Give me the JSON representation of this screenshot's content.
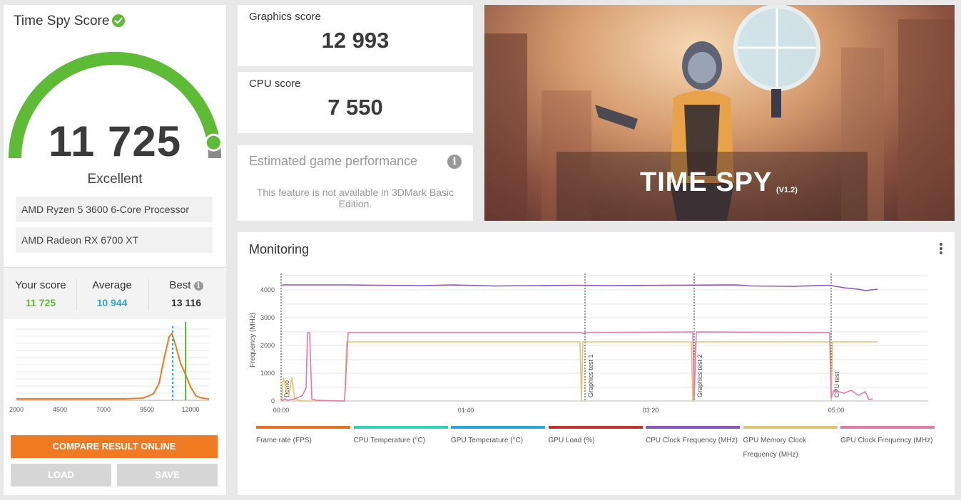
{
  "left": {
    "title": "Time Spy Score",
    "score": "11 725",
    "rating": "Excellent",
    "hardware": [
      "AMD Ryzen 5 3600 6-Core Processor",
      "AMD Radeon RX 6700 XT"
    ],
    "gauge_fraction": 0.95,
    "compare": {
      "your_label": "Your score",
      "your_value": "11 725",
      "avg_label": "Average",
      "avg_value": "10 944",
      "best_label": "Best",
      "best_value": "13 116"
    },
    "hist_ticks": [
      "2000",
      "4500",
      "7000",
      "9500",
      "12000"
    ],
    "buttons": {
      "compare": "COMPARE RESULT ONLINE",
      "load": "LOAD",
      "save": "SAVE"
    },
    "colors": {
      "green": "#5dbb36",
      "blue": "#29a9e0",
      "orange": "#f07a21"
    }
  },
  "graphics": {
    "label": "Graphics score",
    "value": "12 993"
  },
  "cpu": {
    "label": "CPU score",
    "value": "7 550"
  },
  "estimate": {
    "title": "Estimated game performance",
    "message": "This feature is not available in 3DMark Basic Edition."
  },
  "hero": {
    "title": "TIME SPY",
    "version": "(V1.2)"
  },
  "monitoring": {
    "title": "Monitoring",
    "y_axis_label": "Frequency (MHz)",
    "y_ticks": [
      "0",
      "1000",
      "2000",
      "3000",
      "4000"
    ],
    "x_ticks": [
      "00:00",
      "01:40",
      "03:20",
      "05:00"
    ],
    "markers": [
      "Demo",
      "Graphics test 1",
      "Graphics test 2",
      "CPU test"
    ],
    "legend": [
      {
        "label": "Frame rate (FPS)",
        "color": "#e8731f"
      },
      {
        "label": "CPU Temperature (°C)",
        "color": "#2fd6b3"
      },
      {
        "label": "GPU Temperature (°C)",
        "color": "#29a9e0"
      },
      {
        "label": "GPU Load (%)",
        "color": "#c8312f"
      },
      {
        "label": "CPU Clock Frequency (MHz)",
        "color": "#8e52c9"
      },
      {
        "label": "GPU Memory Clock Frequency (MHz)",
        "color": "#e3c474"
      },
      {
        "label": "GPU Clock Frequency (MHz)",
        "color": "#e47aa8"
      }
    ]
  }
}
